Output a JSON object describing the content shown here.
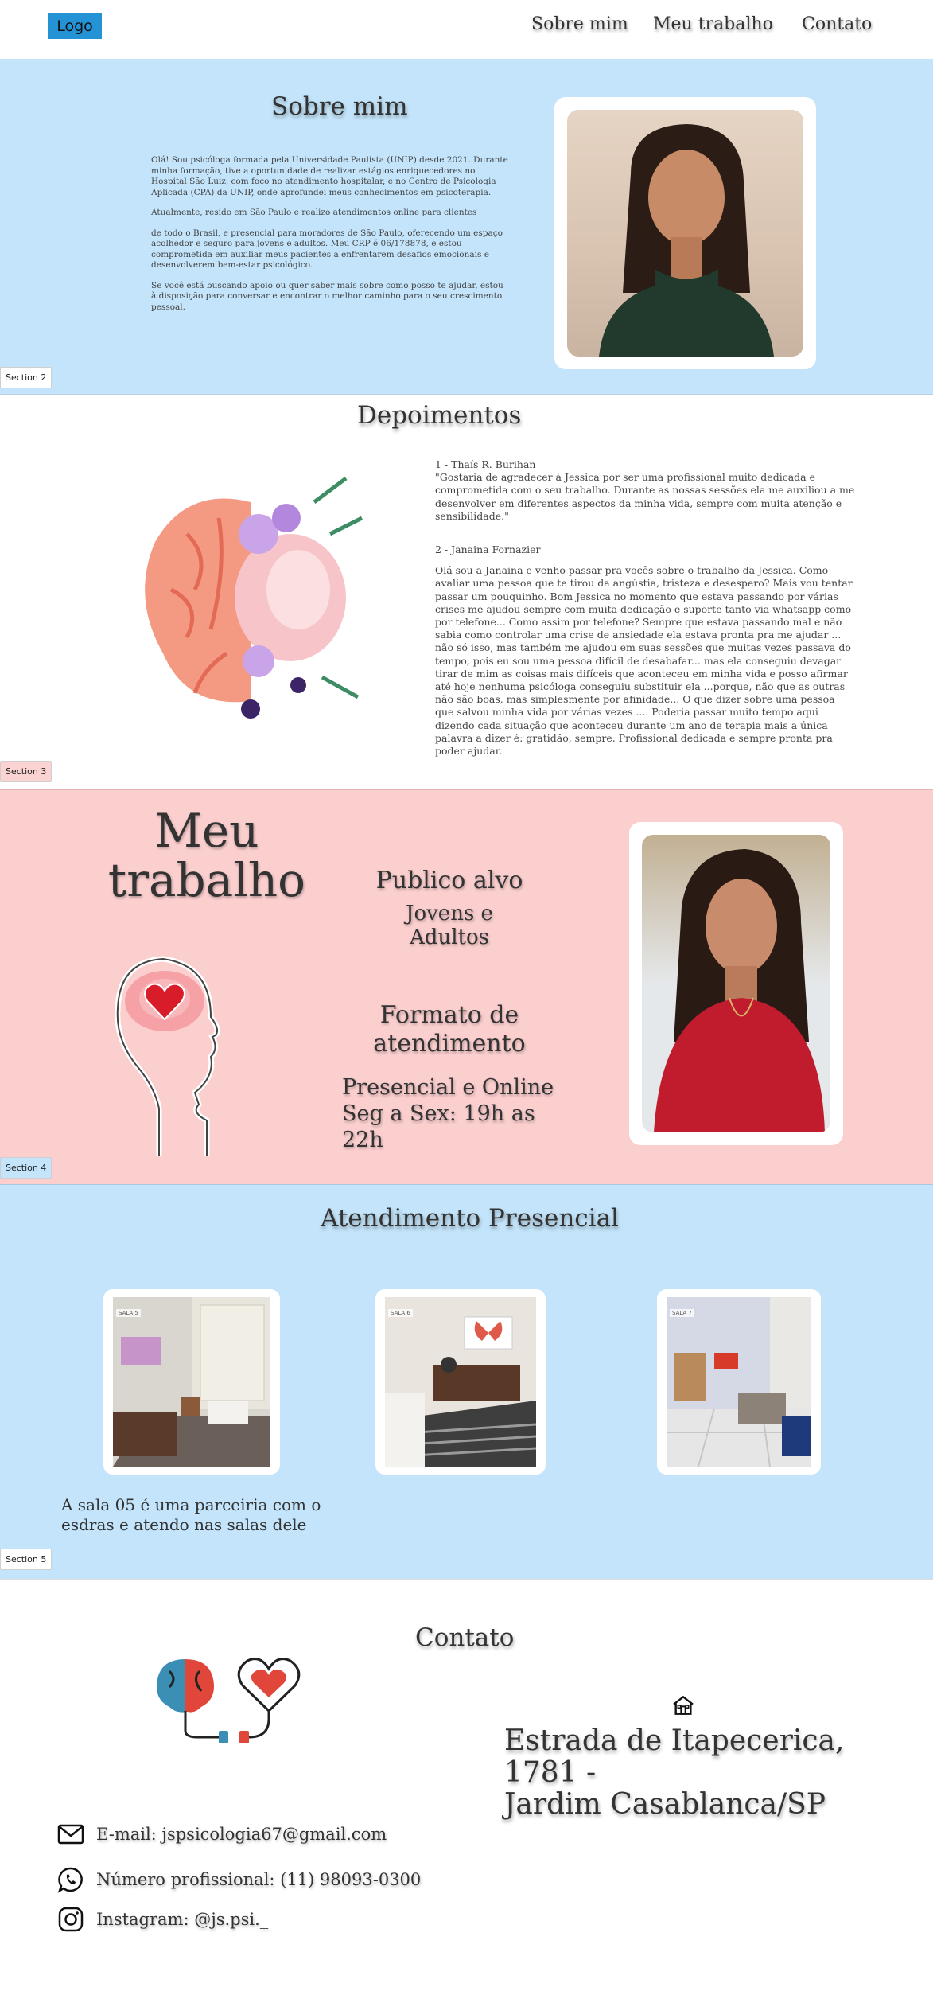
{
  "nav": {
    "logo": "Logo",
    "links": [
      "Sobre mim",
      "Meu trabalho",
      "Contato"
    ]
  },
  "sobre": {
    "title": "Sobre mim",
    "paragraphs": [
      "Olá! Sou psicóloga formada pela Universidade Paulista (UNIP) desde 2021. Durante minha formação, tive a oportunidade de realizar estágios enriquecedores no Hospital São Luiz, com foco no atendimento hospitalar, e no Centro de Psicologia Aplicada (CPA) da UNIP, onde aprofundei meus conhecimentos em psicoterapia.",
      "Atualmente, resido em São Paulo e realizo atendimentos online para clientes",
      "de todo o Brasil, e presencial para moradores de São Paulo, oferecendo um espaço acolhedor e seguro para jovens e adultos. Meu CRP é 06/178878, e estou comprometida em auxiliar meus pacientes a enfrentarem desafios emocionais e desenvolverem bem-estar psicológico.",
      "Se você está buscando apoio ou quer saber mais sobre como posso te ajudar, estou à disposição para conversar e encontrar o melhor caminho para o seu crescimento pessoal."
    ],
    "section_tag": "Section 2"
  },
  "depoimentos": {
    "title": "Depoimentos",
    "items": [
      {
        "author": "1 - Thaís R. Burihan",
        "text": "\"Gostaria de agradecer à Jessica por ser uma profissional muito dedicada e comprometida com o seu trabalho. Durante as nossas sessões ela me auxiliou a me desenvolver em diferentes aspectos da minha vida, sempre com muita atenção e sensibilidade.\""
      },
      {
        "author": "2 - Janaina Fornazier",
        "text": "Olá sou a Janaina e venho passar pra vocês sobre o trabalho da Jessica. Como avaliar uma pessoa que te tirou da angústia, tristeza e desespero? Mais vou tentar passar um pouquinho. Bom Jessica no momento que estava passando por várias crises me ajudou sempre com muita dedicação e suporte tanto via whatsapp como por telefone... Como assim por telefone? Sempre que estava passando mal e não sabia como controlar uma crise de ansiedade ela estava pronta pra me ajudar ... não só isso, mas também me ajudou em suas sessões que muitas vezes passava do tempo, pois eu sou uma pessoa difícil de desabafar... mas ela conseguiu devagar tirar de mim as coisas mais difíceis que aconteceu em minha vida e posso afirmar até hoje nenhuma psicóloga conseguiu substituir ela ...porque, não que as outras não são boas, mas simplesmente por afinidade... O que dizer sobre uma pessoa que salvou minha vida por várias vezes .... Poderia passar muito tempo aqui dizendo cada situação que aconteceu durante um ano de terapia mais a única palavra a dizer é: gratidão, sempre. Profissional dedicada e sempre pronta pra poder ajudar."
      }
    ],
    "section_tag": "Section 3"
  },
  "trabalho": {
    "title_line1": "Meu",
    "title_line2": "trabalho",
    "publico_title": "Publico alvo",
    "publico_line1": "Jovens e",
    "publico_line2": "Adultos",
    "formato_line1": "Formato de",
    "formato_line2": "atendimento",
    "modo": "Presencial e Online",
    "horario": "Seg a Sex: 19h as 22h",
    "section_tag": "Section 4"
  },
  "presencial": {
    "title": "Atendimento Presencial",
    "rooms": [
      "SALA 5",
      "SALA 6",
      "SALA 7"
    ],
    "note": "A sala 05 é uma parceiria com o esdras e atendo nas salas dele",
    "section_tag": "Section 5"
  },
  "contato": {
    "title": "Contato",
    "address_line1": "Estrada de Itapecerica, 1781 -",
    "address_line2": "Jardim Casablanca/SP",
    "email": "E-mail: jspsicologia67@gmail.com",
    "phone": "Número profissional: (11) 98093-0300",
    "instagram": "Instagram: @js.psi._"
  },
  "colors": {
    "light_blue": "#c3e4fa",
    "pink": "#fccfcf",
    "logo_blue": "#2493d6"
  }
}
